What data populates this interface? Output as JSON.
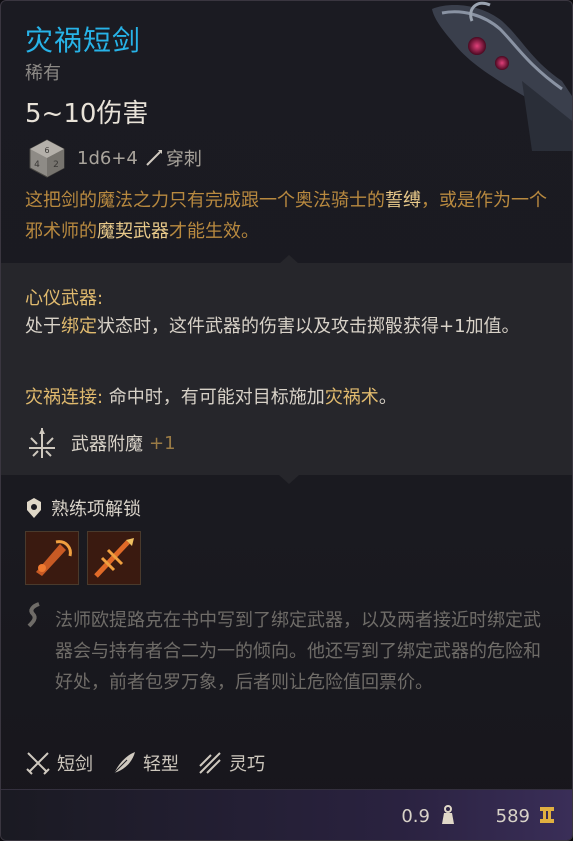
{
  "item": {
    "name": "灾祸短剑",
    "rarity": "稀有",
    "damage": "5~10伤害",
    "dice": "1d6+4",
    "damage_type": "穿刺",
    "description": {
      "part1": "这把剑的魔法之力只有完成跟一个奥法骑士的",
      "hl1": "誓缚",
      "part2": "，或是作为一个邪术师的",
      "hl2": "魔契武器",
      "part3": "才能生效。"
    }
  },
  "passive": {
    "heading": "心仪武器:",
    "line1_pre": "处于",
    "line1_hl": "绑定",
    "line1_post": "状态时，这件武器的伤害以及攻击掷骰获得+1加值。",
    "bane_label": "灾祸连接:",
    "bane_text_pre": " 命中时，有可能对目标施加",
    "bane_text_hl": "灾祸术",
    "bane_text_post": "。",
    "enchant_label": "武器附魔",
    "enchant_value": "+1"
  },
  "proficiency": {
    "label": "熟练项解锁",
    "actions": [
      "slash-action-icon",
      "strike-action-icon"
    ]
  },
  "lore": "法师欧提路克在书中写到了绑定武器，以及两者接近时绑定武器会与持有者合二为一的倾向。他还写到了绑定武器的危险和好处，前者包罗万象，后者则让危险值回票价。",
  "tags": [
    {
      "icon": "crossed-swords-icon",
      "label": "短剑"
    },
    {
      "icon": "feather-icon",
      "label": "轻型"
    },
    {
      "icon": "finesse-icon",
      "label": "灵巧"
    }
  ],
  "footer": {
    "weight": "0.9",
    "value": "589"
  },
  "colors": {
    "title": "#27b3e8",
    "highlight": "#e0ba6e",
    "description": "#b8893f",
    "lore": "#6f6c68"
  }
}
